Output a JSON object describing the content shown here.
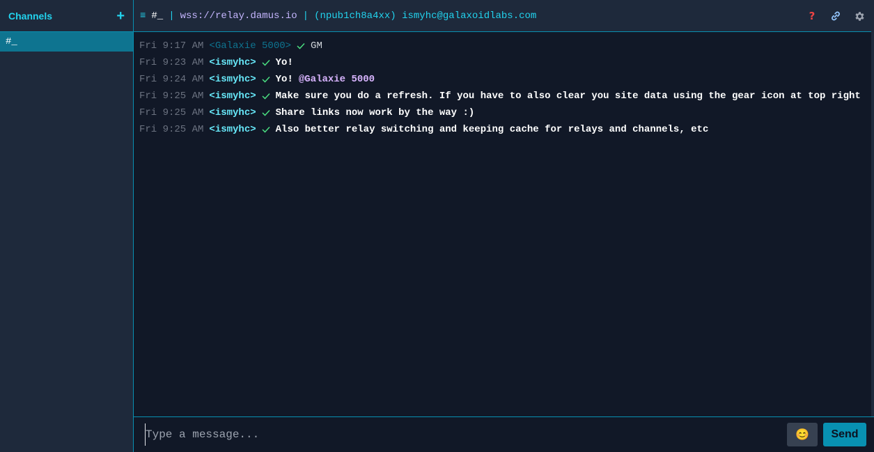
{
  "sidebar": {
    "title": "Channels",
    "add_label": "+",
    "channels": [
      {
        "label": "#_",
        "active": true
      }
    ]
  },
  "topbar": {
    "menu_icon": "≡",
    "channel": "#_",
    "separator": "|",
    "relay": "wss://relay.damus.io",
    "identity": "(npub1ch8a4xx) ismyhc@galaxoidlabs.com",
    "icons": [
      "help-icon",
      "link-icon",
      "gear-icon"
    ]
  },
  "messages": [
    {
      "time": "Fri 9:17 AM",
      "nick": "<Galaxie 5000>",
      "text": "GM",
      "mention": "",
      "self": false
    },
    {
      "time": "Fri 9:23 AM",
      "nick": "<ismyhc>",
      "text": "Yo!",
      "mention": "",
      "self": true
    },
    {
      "time": "Fri 9:24 AM",
      "nick": "<ismyhc>",
      "text": "Yo!",
      "mention": "@Galaxie 5000",
      "self": true
    },
    {
      "time": "Fri 9:25 AM",
      "nick": "<ismyhc>",
      "text": "Make sure you do a refresh. If you have to also clear you site data using the gear icon at top right",
      "mention": "",
      "self": true
    },
    {
      "time": "Fri 9:25 AM",
      "nick": "<ismyhc>",
      "text": "Share links now work by the way :)",
      "mention": "",
      "self": true
    },
    {
      "time": "Fri 9:25 AM",
      "nick": "<ismyhc>",
      "text": "Also better relay switching and keeping cache for relays and channels, etc",
      "mention": "",
      "self": true
    }
  ],
  "composer": {
    "placeholder": "Type a message...",
    "emoji": "😊",
    "send_label": "Send"
  },
  "colors": {
    "accent": "#0891b2",
    "sidebar_bg": "#1e293b",
    "main_bg": "#111827",
    "relay": "#c4b5fd",
    "mention": "#d8b4fe",
    "check": "#4ade80"
  }
}
